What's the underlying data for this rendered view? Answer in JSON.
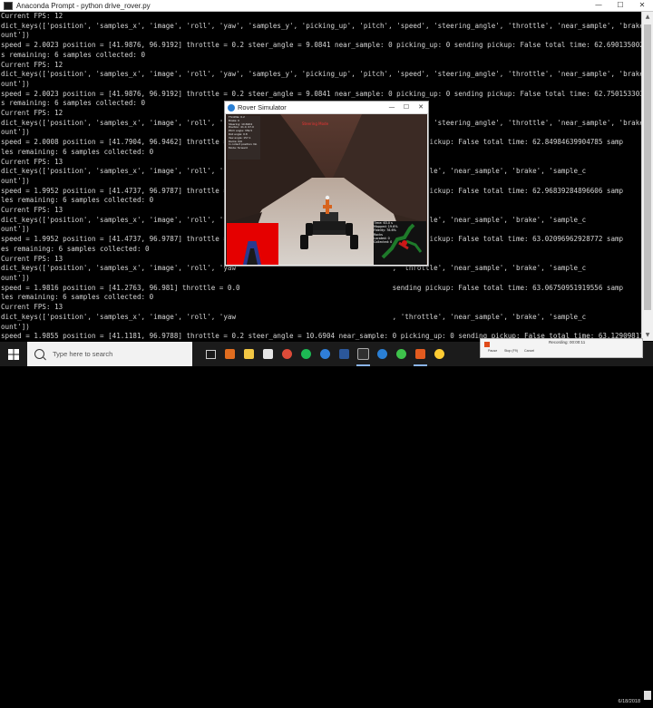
{
  "console": {
    "title": "Anaconda Prompt - python  drive_rover.py",
    "lines": [
      "Current FPS: 12",
      "dict_keys(['position', 'samples_x', 'image', 'roll', 'yaw', 'samples_y', 'picking_up', 'pitch', 'speed', 'steering_angle', 'throttle', 'near_sample', 'brake', 'sample_c",
      "ount'])",
      "speed = 2.0023 position = [41.9876, 96.9192] throttle = 0.2 steer_angle = 9.0841 near_sample: 0 picking_up: 0 sending pickup: False total time: 62.69013500213623 sample",
      "s remaining: 6 samples collected: 0",
      "Current FPS: 12",
      "dict_keys(['position', 'samples_x', 'image', 'roll', 'yaw', 'samples_y', 'picking_up', 'pitch', 'speed', 'steering_angle', 'throttle', 'near_sample', 'brake', 'sample_c",
      "ount'])",
      "speed = 2.0023 position = [41.9876, 96.9192] throttle = 0.2 steer_angle = 9.0841 near_sample: 0 picking_up: 0 sending pickup: False total time: 62.75015330314636 sample",
      "s remaining: 6 samples collected: 0",
      "Current FPS: 12",
      "dict_keys(['position', 'samples_x', 'image', 'roll', 'yaw', 'samples_y', 'picking_up', 'pitch', 'speed', 'steering_angle', 'throttle', 'near_sample', 'brake', 'sample_c",
      "ount'])",
      "speed = 2.0008 position = [41.7904, 96.9462] throttle = 0.2                                    sending pickup: False total time: 62.84984639904785 samp",
      "les remaining: 6 samples collected: 0",
      "Current FPS: 13",
      "dict_keys(['position', 'samples_x', 'image', 'roll', 'yaw                                      , 'throttle', 'near_sample', 'brake', 'sample_c",
      "ount'])",
      "speed = 1.9952 position = [41.4737, 96.9787] throttle = 0.0                                    sending pickup: False total time: 62.96839284896606 samp",
      "les remaining: 6 samples collected: 0",
      "Current FPS: 13",
      "dict_keys(['position', 'samples_x', 'image', 'roll', 'yaw                                      , 'throttle', 'near_sample', 'brake', 'sample_c",
      "ount'])",
      "speed = 1.9952 position = [41.4737, 96.9787] throttle = 0.0                                    sending pickup: False total time: 63.02096962928772 samp",
      "es remaining: 6 samples collected: 0",
      "Current FPS: 13",
      "dict_keys(['position', 'samples_x', 'image', 'roll', 'yaw                                      , 'throttle', 'near_sample', 'brake', 'sample_c",
      "ount'])",
      "speed = 1.9816 position = [41.2763, 96.981] throttle = 0.0                                     sending pickup: False total time: 63.06750951919556 samp",
      "les remaining: 6 samples collected: 0",
      "Current FPS: 13",
      "dict_keys(['position', 'samples_x', 'image', 'roll', 'yaw                                      , 'throttle', 'near_sample', 'brake', 'sample_c",
      "ount'])",
      "speed = 1.9855 position = [41.1181, 96.9788] throttle = 0.2 steer_angle = 10.6904 near_sample: 0 picking_up: 0 sending pickup: False total time: 63.12909817695618 sampl",
      "es remaining: 6 samples collected: 0",
      "Current FPS: 13",
      "dict_keys(['position', 'samples_x', 'image', 'roll', 'yaw', 'samples_y', 'picking_up', 'pitch', 'speed', 'steering_angle', 'throttle', 'near_sample', 'brake', 'sample_c",
      "ount'])",
      "speed = 1.987 position = [41.0387, 96.9762] throttle = 0.2 steer_angle = 10.6904 near_sample: 0 picking_up: 0 sending pickup: False total time: 63.19803905487060 sampl",
      "es remaining: 6 samples collected: 0"
    ]
  },
  "rover_window": {
    "title": "Rover Simulator",
    "red_text": "Steering Mode",
    "telemetry": [
      "Throttle: 0.2",
      "Brake: 0",
      "Steering: 10.6904",
      "Position: 41.0, 97.0",
      "Pitch angle: 359.5",
      "Roll angle: 0.8",
      "Yaw angle: 157.1",
      "Rocks: 0/6",
      "In collect position: No",
      "Mode: forward"
    ],
    "pickup_overlay": [
      "Time: 63.0 s",
      "Mapped: 19.6%",
      "Fidelity: 78.6%",
      "Rocks",
      "Located: 0",
      "Collected: 0"
    ]
  },
  "taskbar": {
    "search_placeholder": "Type here to search",
    "date": "6/18/2018"
  },
  "recording": {
    "label": "Recording: 00:00:11",
    "buttons": [
      "Pause",
      "Stop (F9)",
      "Cancel"
    ]
  }
}
